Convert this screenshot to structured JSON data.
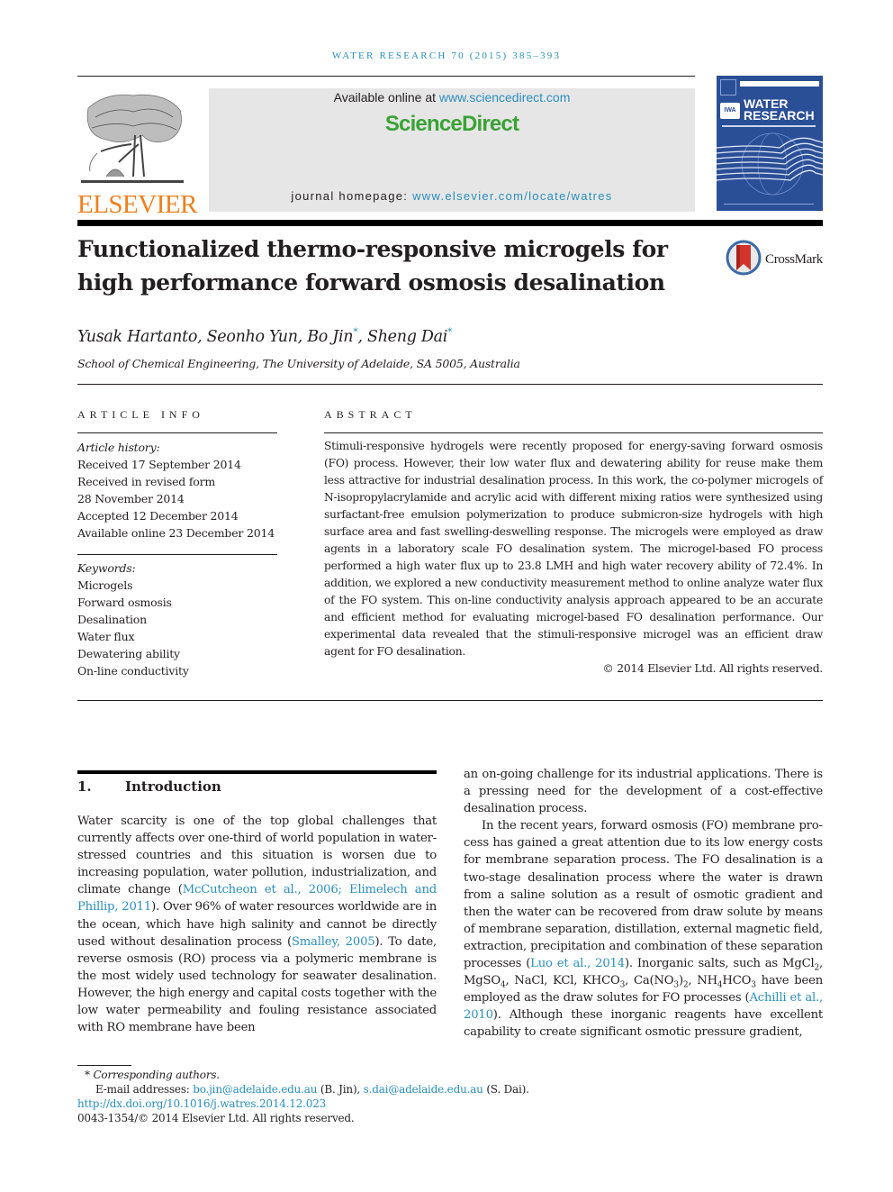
{
  "running_head": "WATER RESEARCH 70 (2015) 385–393",
  "masthead": {
    "publisher": "ELSEVIER",
    "available_online_prefix": "Available online at ",
    "available_online_link": "www.sciencedirect.com",
    "sciencedirect_logo": "ScienceDirect",
    "journal_homepage_prefix": "journal homepage: ",
    "journal_homepage_link": "www.elsevier.com/locate/watres",
    "cover": {
      "title_line1": "WATER",
      "title_line2": "RESEARCH",
      "badge": "IWA"
    },
    "colors": {
      "elsevier_orange": "#f07f1c",
      "sciencedirect_green": "#3aa335",
      "link_blue": "#2a8fbd",
      "cover_blue": "#2b4f97"
    }
  },
  "article": {
    "title_line1": "Functionalized thermo-responsive microgels for",
    "title_line2": "high performance forward osmosis desalination",
    "crossmark_label": "CrossMark",
    "authors": [
      {
        "name": "Yusak Hartanto",
        "corresponding": false
      },
      {
        "name": "Seonho Yun",
        "corresponding": false
      },
      {
        "name": "Bo Jin",
        "corresponding": true
      },
      {
        "name": "Sheng Dai",
        "corresponding": true
      }
    ],
    "authors_sep": ", ",
    "corresponding_mark": "*",
    "affiliation": "School of Chemical Engineering, The University of Adelaide, SA 5005, Australia"
  },
  "article_info": {
    "heading": "ARTICLE INFO",
    "history_label": "Article history:",
    "history": [
      "Received 17 September 2014",
      "Received in revised form",
      "28 November 2014",
      "Accepted 12 December 2014",
      "Available online 23 December 2014"
    ],
    "keywords_label": "Keywords:",
    "keywords": [
      "Microgels",
      "Forward osmosis",
      "Desalination",
      "Water flux",
      "Dewatering ability",
      "On-line conductivity"
    ]
  },
  "abstract": {
    "heading": "ABSTRACT",
    "text": "Stimuli-responsive hydrogels were recently proposed for energy-saving forward osmosis (FO) process. However, their low water flux and dewatering ability for reuse make them less attractive for industrial desalination process. In this work, the co-polymer microgels of N-isopropylacrylamide and acrylic acid with different mixing ratios were synthesized using surfactant-free emulsion polymerization to produce submicron-size hydrogels with high surface area and fast swelling-deswelling response. The microgels were employed as draw agents in a laboratory scale FO desalination system. The microgel-based FO process performed a high water flux up to 23.8 LMH and high water recovery ability of 72.4%. In addition, we explored a new conductivity measurement method to online analyze water flux of the FO system. This on-line conductivity analysis approach appeared to be an ac­curate and efficient method for evaluating microgel-based FO desalination performance. Our experimental data revealed that the stimuli-responsive microgel was an efficient draw agent for FO desalination.",
    "copyright": "© 2014 Elsevier Ltd. All rights reserved."
  },
  "introduction": {
    "number": "1.",
    "heading": "Introduction",
    "left_p1_a": "Water scarcity is one of the top global challenges that currently affects over one-third of world population in water-stressed countries and this situation is worsen due to increasing population, water pollution, industrializa­tion, and climate change (",
    "left_cite1": "McCutcheon et al., 2006; Elimelech and Phillip, 2011",
    "left_p1_b": "). Over 96% of water resources worldwide are in the ocean, which have high salinity and cannot be directly used without desalination process (",
    "left_cite2": "Smalley, 2005",
    "left_p1_c": "). To date, reverse osmosis (RO) process via a polymeric membrane is the most widely used technology for seawater desalination. However, the high energy and capital costs together with the low water permeability and fouling resistance associated with RO membrane have been",
    "right_p1": "an on-going challenge for its industrial applications. There is a pressing need for the development of a cost-effective desalination process.",
    "right_p2_a": "In the recent years, forward osmosis (FO) membrane pro­cess has gained a great attention due to its low energy costs for membrane separation process. The FO desalination is a two-stage desalination process where the water is drawn from a saline solution as a result of osmotic gradient and then the water can be recovered from draw solute by means of mem­brane separation, distillation, external magnetic field, extraction, precipitation and combination of these separation processes (",
    "right_cite1": "Luo et al., 2014",
    "right_p2_b": "). Inorganic salts, such as MgCl",
    "sub_2": "2",
    "sub_4": "4",
    "sub_3": "3",
    "right_p2_c": ", MgSO",
    "right_p2_d": ", NaCl, KCl, KHCO",
    "right_p2_e": ", Ca(NO",
    "right_p2_f": ")",
    "right_p2_g": ", NH",
    "right_p2_h": "HCO",
    "right_p2_i": " have been employed as the draw solutes for FO processes (",
    "right_cite2": "Achilli et al., 2010",
    "right_p2_j": "). Although these inorganic reagents have excellent capability to create significant osmotic pressure gradient,"
  },
  "footnotes": {
    "star": "*",
    "corresponding": "Corresponding authors.",
    "email_label": "E-mail addresses: ",
    "email1": "bo.jin@adelaide.edu.au",
    "email1_owner": " (B. Jin), ",
    "email2": "s.dai@adelaide.edu.au",
    "email2_owner": " (S. Dai).",
    "doi": "http://dx.doi.org/10.1016/j.watres.2014.12.023",
    "issn_copyright": "0043-1354/© 2014 Elsevier Ltd. All rights reserved."
  }
}
